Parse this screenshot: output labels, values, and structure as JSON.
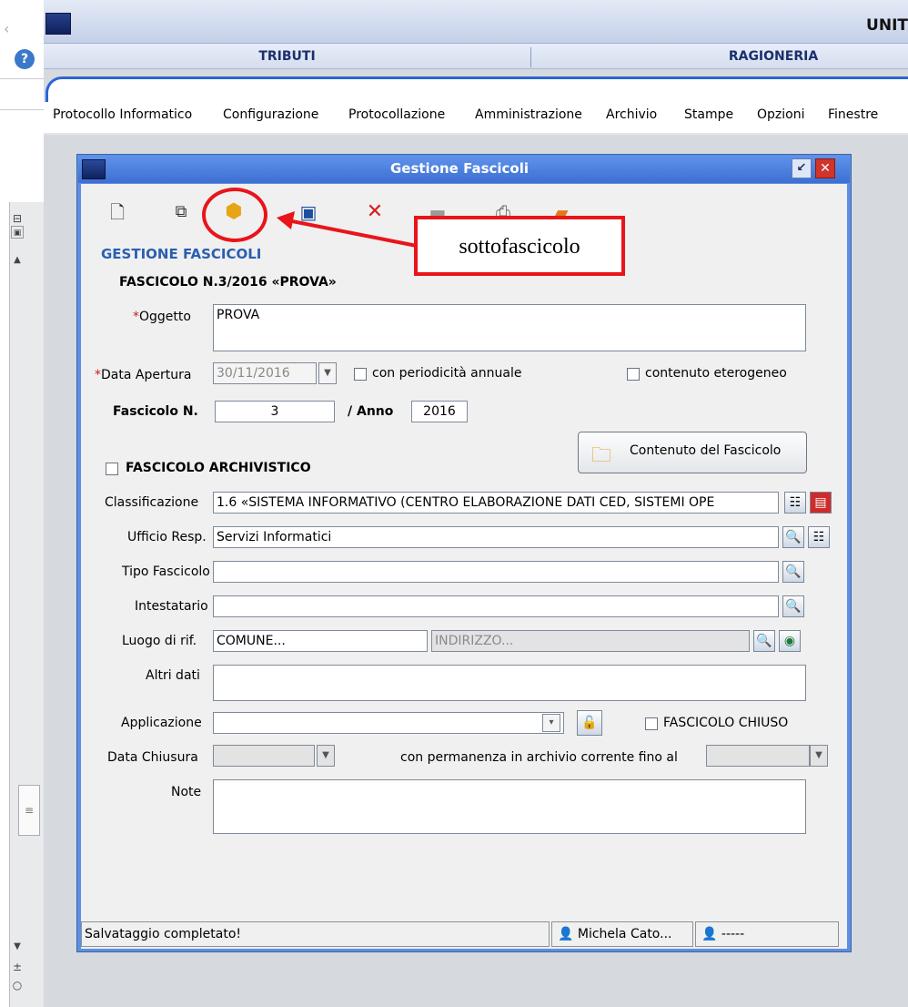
{
  "window": {
    "title": "UNIT"
  },
  "top_tabs": [
    {
      "label": "TRIBUTI"
    },
    {
      "label": "RAGIONERIA"
    }
  ],
  "menu": [
    {
      "label": "Protocollo Informatico"
    },
    {
      "label": "Configurazione"
    },
    {
      "label": "Protocollazione"
    },
    {
      "label": "Amministrazione"
    },
    {
      "label": "Archivio"
    },
    {
      "label": "Stampe"
    },
    {
      "label": "Opzioni"
    },
    {
      "label": "Finestre"
    }
  ],
  "dialog": {
    "title": "Gestione Fascicoli",
    "heading": "GESTIONE FASCICOLI",
    "subheading": "FASCICOLO N.3/2016 «PROVA»",
    "annotation": "sottofascicolo",
    "required_mark": "*",
    "fields": {
      "oggetto_label": "Oggetto",
      "oggetto_value": "PROVA",
      "data_apertura_label": "Data Apertura",
      "data_apertura_value": "30/11/2016",
      "periodicita_label": "con periodicità annuale",
      "eterogeneo_label": "contenuto eterogeneo",
      "fascicolo_n_label": "Fascicolo N.",
      "fascicolo_n_value": "3",
      "anno_label": "/ Anno",
      "anno_value": "2016",
      "contenuto_button": "Contenuto del Fascicolo",
      "archivistico_label": "FASCICOLO ARCHIVISTICO",
      "classificazione_label": "Classificazione",
      "classificazione_value": "1.6 «SISTEMA INFORMATIVO (CENTRO ELABORAZIONE DATI CED, SISTEMI OPE",
      "ufficio_label": "Ufficio Resp.",
      "ufficio_value": "Servizi Informatici",
      "tipo_label": "Tipo Fascicolo",
      "intestatario_label": "Intestatario",
      "luogo_label": "Luogo di rif.",
      "luogo_comune_value": "COMUNE...",
      "luogo_indirizzo_value": "INDIRIZZO...",
      "altri_label": "Altri dati",
      "applicazione_label": "Applicazione",
      "chiuso_label": "FASCICOLO CHIUSO",
      "data_chiusura_label": "Data Chiusura",
      "permanenza_label": "con permanenza in archivio corrente fino al",
      "note_label": "Note"
    },
    "status": {
      "message": "Salvataggio completato!",
      "user": "Michela Cato...",
      "extra": "-----"
    }
  },
  "colors": {
    "accent": "#2a66d4",
    "annotation": "#e8151b",
    "title_bar": "#4a7fdc",
    "heading": "#2b5fb0"
  }
}
